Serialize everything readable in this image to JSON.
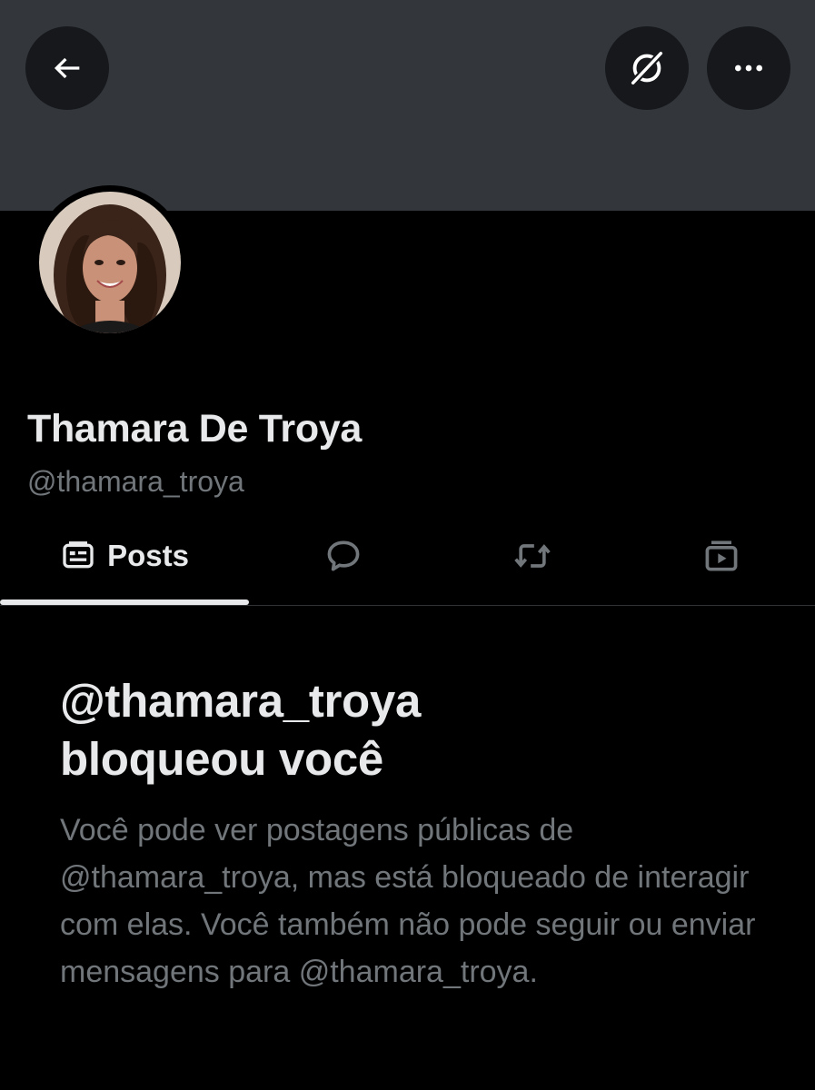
{
  "header": {
    "back_icon": "arrow-left-icon",
    "grok_icon": "grok-icon",
    "more_icon": "more-horizontal-icon"
  },
  "profile": {
    "display_name": "Thamara De Troya",
    "handle": "@thamara_troya"
  },
  "tabs": [
    {
      "label": "Posts",
      "icon": "posts-icon",
      "active": true
    },
    {
      "label": "",
      "icon": "replies-icon",
      "active": false
    },
    {
      "label": "",
      "icon": "reposts-icon",
      "active": false
    },
    {
      "label": "",
      "icon": "media-icon",
      "active": false
    }
  ],
  "blocked": {
    "title_line1": "@thamara_troya",
    "title_line2": "bloqueou você",
    "description": "Você pode ver postagens públicas de @thamara_troya, mas está bloqueado de interagir com elas. Você também não pode seguir ou enviar mensagens para @thamara_troya."
  },
  "colors": {
    "background": "#000000",
    "banner": "#33373c",
    "primary_text": "#e7e9ea",
    "secondary_text": "#71767b"
  }
}
